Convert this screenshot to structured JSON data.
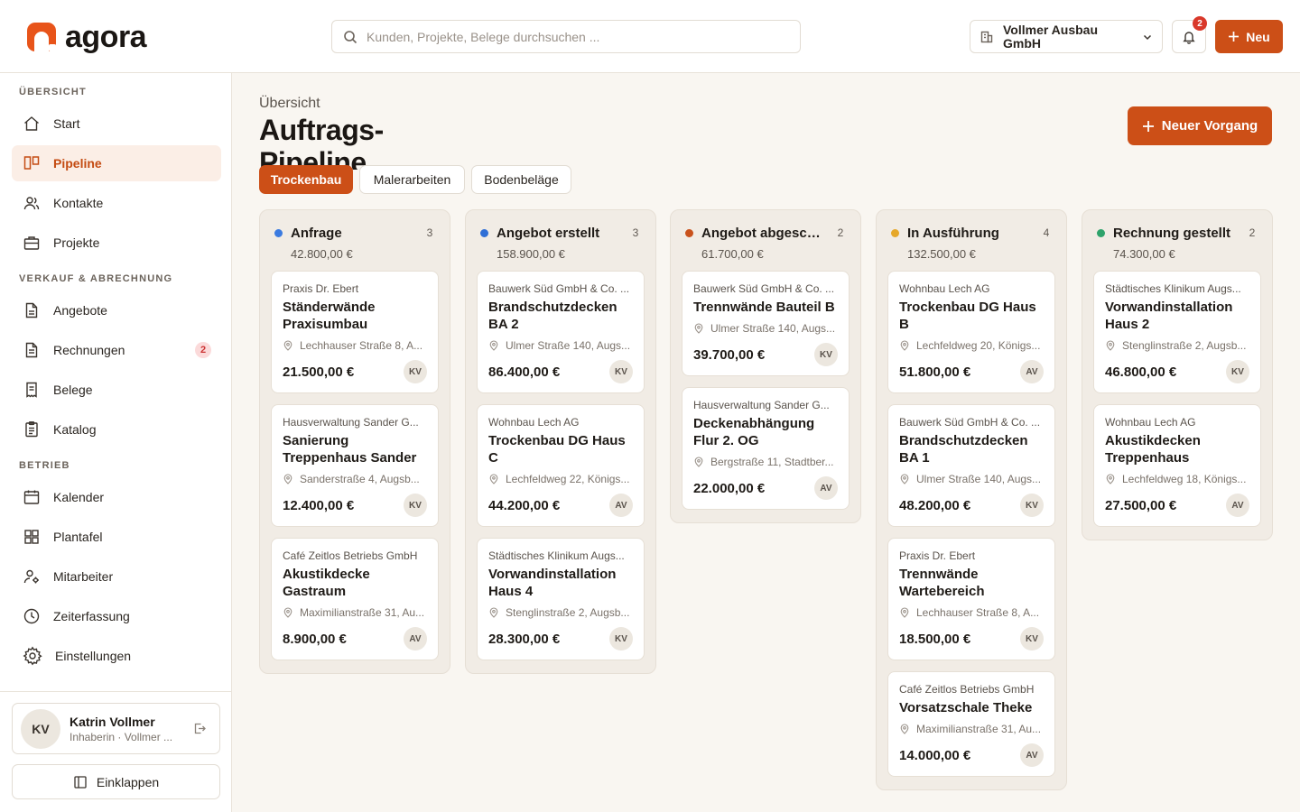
{
  "brand": {
    "name": "agora"
  },
  "header": {
    "search_placeholder": "Kunden, Projekte, Belege durchsuchen ...",
    "company": "Vollmer Ausbau GmbH",
    "notification_count": "2",
    "new_button": "Neu"
  },
  "sidebar": {
    "sections": {
      "overview": "ÜBERSICHT",
      "sales": "VERKAUF & ABRECHNUNG",
      "operations": "BETRIEB"
    },
    "items": [
      {
        "label": "Start",
        "icon": "home-icon"
      },
      {
        "label": "Pipeline",
        "icon": "pipeline-icon",
        "active": true
      },
      {
        "label": "Kontakte",
        "icon": "users-icon"
      },
      {
        "label": "Projekte",
        "icon": "briefcase-icon"
      },
      {
        "label": "Angebote",
        "icon": "document-icon"
      },
      {
        "label": "Rechnungen",
        "icon": "invoice-icon",
        "badge": "2"
      },
      {
        "label": "Belege",
        "icon": "receipt-icon"
      },
      {
        "label": "Katalog",
        "icon": "catalog-icon"
      },
      {
        "label": "Kalender",
        "icon": "calendar-icon"
      },
      {
        "label": "Plantafel",
        "icon": "grid-icon"
      },
      {
        "label": "Mitarbeiter",
        "icon": "employee-icon"
      },
      {
        "label": "Zeiterfassung",
        "icon": "clock-icon"
      },
      {
        "label": "Einstellungen",
        "icon": "gear-icon"
      }
    ],
    "user": {
      "initials": "KV",
      "name": "Katrin Vollmer",
      "role": "Inhaberin · Vollmer ..."
    },
    "collapse_label": "Einklappen"
  },
  "main": {
    "breadcrumb": "Übersicht",
    "title": "Auftrags-Pipeline",
    "new_process_button": "Neuer Vorgang",
    "tabs": [
      {
        "label": "Trockenbau",
        "active": true
      },
      {
        "label": "Malerarbeiten"
      },
      {
        "label": "Bodenbeläge"
      }
    ],
    "columns": [
      {
        "title": "Anfrage",
        "count": "3",
        "sum": "42.800,00 €",
        "color": "#3b7be0",
        "cards": [
          {
            "client": "Praxis Dr. Ebert",
            "title": "Ständerwände Praxisumbau",
            "address": "Lechhauser Straße 8, A...",
            "amount": "21.500,00 €",
            "owner": "KV"
          },
          {
            "client": "Hausverwaltung Sander G...",
            "title": "Sanierung Treppenhaus Sander",
            "address": "Sanderstraße 4, Augsb...",
            "amount": "12.400,00 €",
            "owner": "KV"
          },
          {
            "client": "Café Zeitlos Betriebs GmbH",
            "title": "Akustikdecke Gastraum",
            "address": "Maximilianstraße 31, Au...",
            "amount": "8.900,00 €",
            "owner": "AV"
          }
        ]
      },
      {
        "title": "Angebot erstellt",
        "count": "3",
        "sum": "158.900,00 €",
        "color": "#2f6fd6",
        "cards": [
          {
            "client": "Bauwerk Süd GmbH & Co. ...",
            "title": "Brandschutzdecken BA 2",
            "address": "Ulmer Straße 140, Augs...",
            "amount": "86.400,00 €",
            "owner": "KV"
          },
          {
            "client": "Wohnbau Lech AG",
            "title": "Trockenbau DG Haus C",
            "address": "Lechfeldweg 22, Königs...",
            "amount": "44.200,00 €",
            "owner": "AV"
          },
          {
            "client": "Städtisches Klinikum Augs...",
            "title": "Vorwandinstallation Haus 4",
            "address": "Stenglinstraße 2, Augsb...",
            "amount": "28.300,00 €",
            "owner": "KV"
          }
        ]
      },
      {
        "title": "Angebot abgeschickt",
        "count": "2",
        "sum": "61.700,00 €",
        "color": "#c9521c",
        "cards": [
          {
            "client": "Bauwerk Süd GmbH & Co. ...",
            "title": "Trennwände Bauteil B",
            "address": "Ulmer Straße 140, Augs...",
            "amount": "39.700,00 €",
            "owner": "KV"
          },
          {
            "client": "Hausverwaltung Sander G...",
            "title": "Deckenabhängung Flur 2. OG",
            "address": "Bergstraße 11, Stadtber...",
            "amount": "22.000,00 €",
            "owner": "AV"
          }
        ]
      },
      {
        "title": "In Ausführung",
        "count": "4",
        "sum": "132.500,00 €",
        "color": "#e6a82a",
        "cards": [
          {
            "client": "Wohnbau Lech AG",
            "title": "Trockenbau DG Haus B",
            "address": "Lechfeldweg 20, Königs...",
            "amount": "51.800,00 €",
            "owner": "AV"
          },
          {
            "client": "Bauwerk Süd GmbH & Co. ...",
            "title": "Brandschutzdecken BA 1",
            "address": "Ulmer Straße 140, Augs...",
            "amount": "48.200,00 €",
            "owner": "KV"
          },
          {
            "client": "Praxis Dr. Ebert",
            "title": "Trennwände Wartebereich",
            "address": "Lechhauser Straße 8, A...",
            "amount": "18.500,00 €",
            "owner": "KV"
          },
          {
            "client": "Café Zeitlos Betriebs GmbH",
            "title": "Vorsatzschale Theke",
            "address": "Maximilianstraße 31, Au...",
            "amount": "14.000,00 €",
            "owner": "AV"
          }
        ]
      },
      {
        "title": "Rechnung gestellt",
        "count": "2",
        "sum": "74.300,00 €",
        "color": "#2ea36b",
        "cards": [
          {
            "client": "Städtisches Klinikum Augs...",
            "title": "Vorwandinstallation Haus 2",
            "address": "Stenglinstraße 2, Augsb...",
            "amount": "46.800,00 €",
            "owner": "KV"
          },
          {
            "client": "Wohnbau Lech AG",
            "title": "Akustikdecken Treppenhaus",
            "address": "Lechfeldweg 18, Königs...",
            "amount": "27.500,00 €",
            "owner": "AV"
          }
        ]
      }
    ]
  }
}
